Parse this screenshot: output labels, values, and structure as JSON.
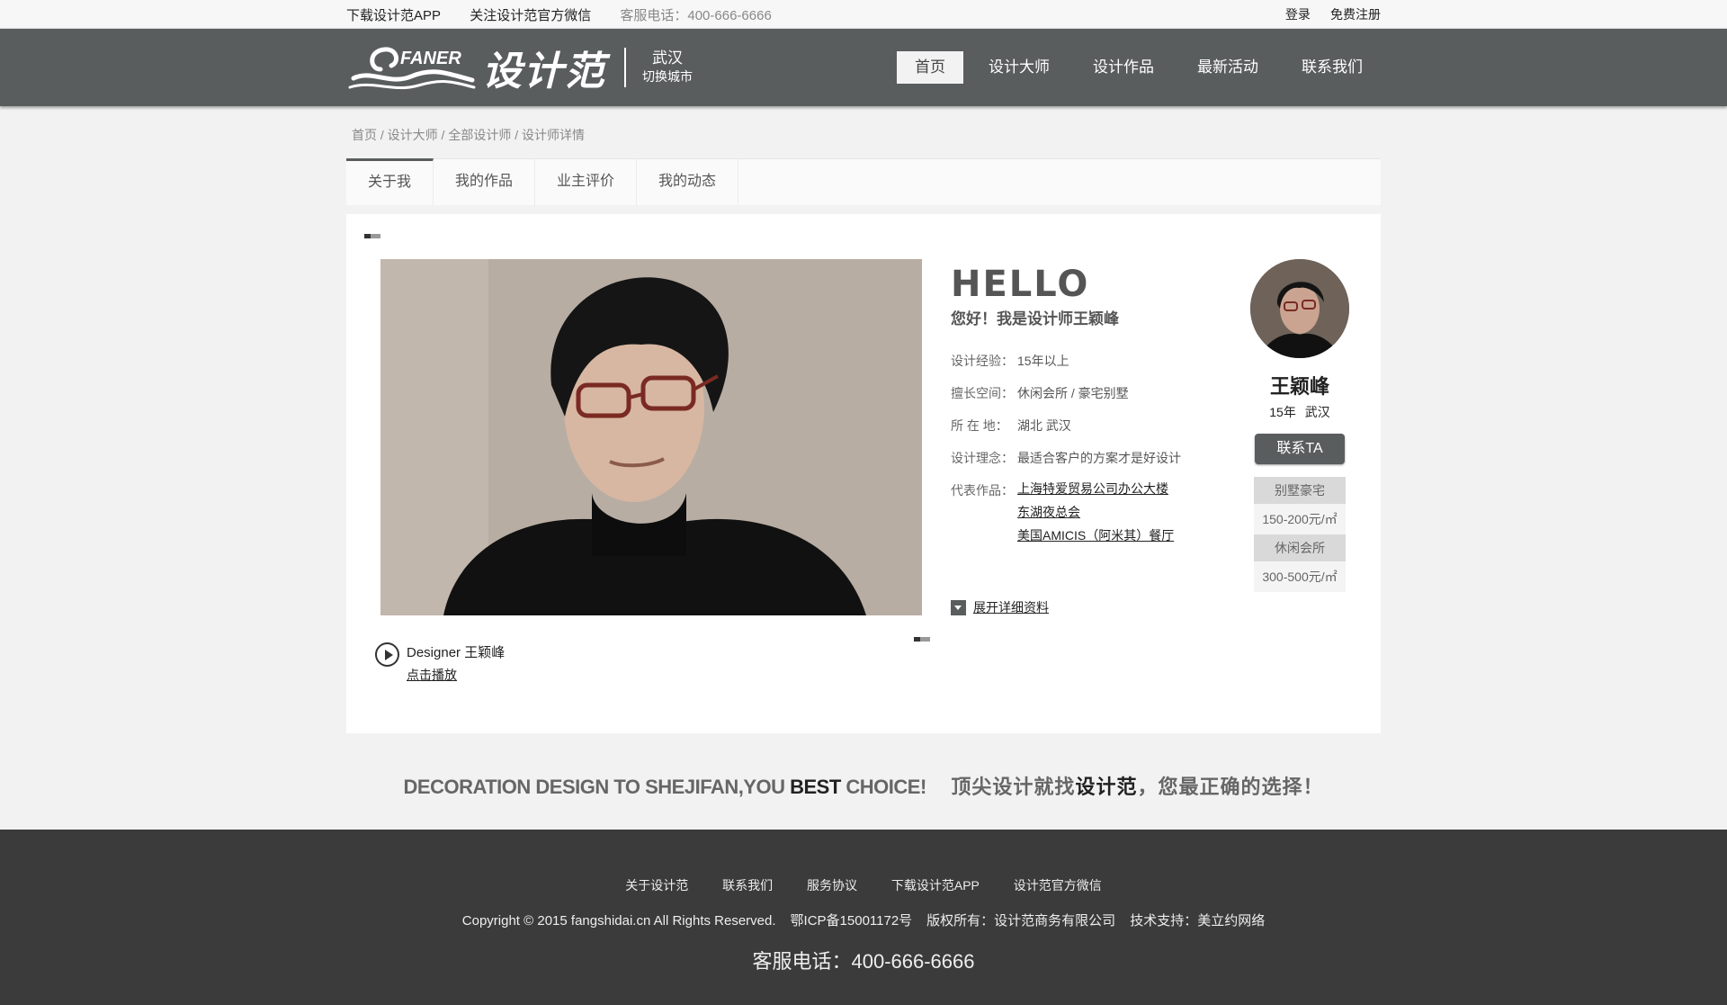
{
  "topbar": {
    "download_app": "下载设计范APP",
    "follow_wechat": "关注设计范官方微信",
    "phone": "客服电话：400-666-6666",
    "login": "登录",
    "register": "免费注册"
  },
  "header": {
    "logo_en": "FANER",
    "logo_cn": "设计范",
    "city": "武汉",
    "switch_city": "切换城市",
    "nav": [
      "首页",
      "设计大师",
      "设计作品",
      "最新活动",
      "联系我们"
    ],
    "nav_active": "首页"
  },
  "breadcrumb": "首页 / 设计大师 / 全部设计师 / 设计师详情",
  "tabs": [
    "关于我",
    "我的作品",
    "业主评价",
    "我的动态"
  ],
  "video": {
    "title": "Designer 王颖峰",
    "play": "点击播放"
  },
  "info": {
    "hello": "HELLO",
    "greeting": "您好！我是设计师王颖峰",
    "rows": [
      {
        "k": "设计经验：",
        "v": "15年以上"
      },
      {
        "k": "擅长空间：",
        "v": "休闲会所 / 豪宅别墅"
      },
      {
        "k": "所 在 地：",
        "v": "湖北 武汉"
      },
      {
        "k": "设计理念：",
        "v": "最适合客户的方案才是好设计"
      }
    ],
    "works_label": "代表作品：",
    "works": [
      "上海特爱贸易公司办公大楼",
      "东湖夜总会",
      "美国AMICIS（阿米其）餐厅"
    ],
    "expand": "展开详细资料"
  },
  "profile": {
    "name": "王颖峰",
    "sub": "15年 武汉",
    "contact": "联系TA",
    "prices": [
      {
        "cat": "别墅豪宅",
        "val": "150-200元/㎡"
      },
      {
        "cat": "休闲会所",
        "val": "300-500元/㎡"
      }
    ]
  },
  "slogan": {
    "en_pre": "DECORATION DESIGN TO SHEJIFAN,YOU ",
    "en_bold": "BEST",
    "en_post": " CHOICE!",
    "cn_pre": "顶尖设计就找",
    "cn_bold": "设计范",
    "cn_post": "，您最正确的选择！"
  },
  "footer": {
    "links": [
      "关于设计范",
      "联系我们",
      "服务协议",
      "下载设计范APP",
      "设计范官方微信"
    ],
    "copyright": "Copyright © 2015 fangshidai.cn All Rights Reserved.",
    "icp": "鄂ICP备15001172号",
    "owner": "版权所有：设计范商务有限公司",
    "tech": "技术支持：美立约网络",
    "phone": "客服电话：400-666-6666"
  },
  "colors": {
    "header_bg": "#5a5d5e",
    "footer_bg": "#3b3b3b",
    "page_bg": "#f2f2f2"
  }
}
